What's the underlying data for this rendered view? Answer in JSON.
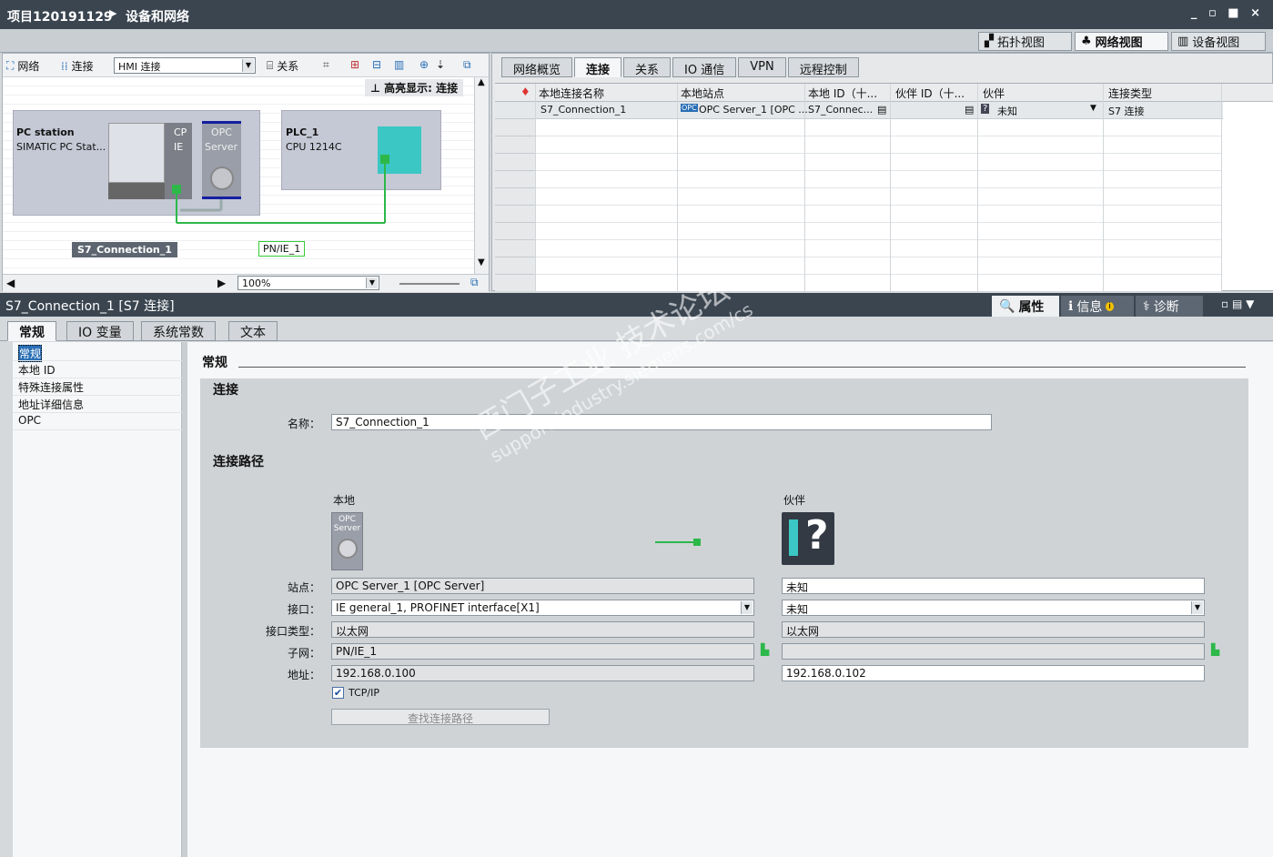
{
  "title_bar": {
    "project": "项目120191129",
    "crumb": "设备和网络",
    "win_controls": "_ ▫ ■ ×"
  },
  "views": {
    "topology": "拓扑视图",
    "network": "网络视图",
    "device": "设备视图"
  },
  "left_toolbar": {
    "network": "网络",
    "connections": "连接",
    "conn_type": "HMI 连接",
    "relations": "关系"
  },
  "highlight": "高亮显示: 连接",
  "devices": {
    "pc_name": "PC station",
    "pc_type": "SIMATIC PC Stat...",
    "cp_label1": "CP",
    "cp_label2": "IE",
    "opc_label1": "OPC",
    "opc_label2": "Server",
    "plc_name": "PLC_1",
    "plc_type": "CPU 1214C",
    "connection_label": "S7_Connection_1",
    "subnet_label": "PN/IE_1"
  },
  "zoom": "100%",
  "right_tabs": [
    "网络概览",
    "连接",
    "关系",
    "IO 通信",
    "VPN",
    "远程控制"
  ],
  "grid": {
    "headers": [
      "本地连接名称",
      "本地站点",
      "本地 ID（十...",
      "伙伴 ID（十...",
      "伙伴",
      "连接类型"
    ],
    "row": {
      "name": "S7_Connection_1",
      "station": "OPC Server_1 [OPC ...",
      "local_id": "S7_Connec...",
      "partner_id": "",
      "partner": "未知",
      "type": "S7 连接"
    }
  },
  "props": {
    "title": "S7_Connection_1 [S7 连接]",
    "tab_props": "属性",
    "tab_info": "信息",
    "tab_diag": "诊断",
    "subtabs": [
      "常规",
      "IO 变量",
      "系统常数",
      "文本"
    ],
    "nav": [
      "常规",
      "本地 ID",
      "特殊连接属性",
      "地址详细信息",
      "OPC"
    ]
  },
  "general": {
    "section": "常规",
    "group_conn": "连接",
    "name_label": "名称：",
    "name_value": "S7_Connection_1",
    "path_title": "连接路径",
    "local_hdr": "本地",
    "partner_hdr": "伙伴",
    "opc_icon_l1": "OPC",
    "opc_icon_l2": "Server",
    "station_label": "站点：",
    "interface_label": "接口：",
    "iftype_label": "接口类型：",
    "subnet_label": "子网：",
    "address_label": "地址：",
    "local_station": "OPC Server_1 [OPC Server]",
    "local_interface": "IE general_1, PROFINET interface[X1]",
    "local_iftype": "以太网",
    "local_subnet": "PN/IE_1",
    "local_address": "192.168.0.100",
    "partner_station": "未知",
    "partner_interface": "未知",
    "partner_iftype": "以太网",
    "partner_subnet": "",
    "partner_address": "192.168.0.102",
    "tcpip": "TCP/IP",
    "find_path_btn": "查找连接路径"
  },
  "watermark": {
    "line1": "西门子工业 技术论坛",
    "line2": "support.industry.siemens.com/cs"
  },
  "colors": {
    "titlebar": "#3a4550",
    "green": "#2db84a",
    "teal": "#3bc7c4"
  }
}
